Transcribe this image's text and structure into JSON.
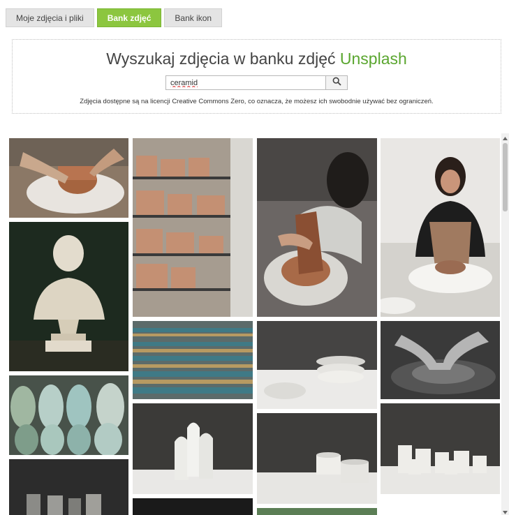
{
  "tabs": [
    {
      "label": "Moje zdjęcia i pliki",
      "active": false
    },
    {
      "label": "Bank zdjęć",
      "active": true
    },
    {
      "label": "Bank ikon",
      "active": false
    }
  ],
  "search": {
    "title_prefix": "Wyszukaj zdjęcia w banku zdjęć ",
    "title_brand": "Unsplash",
    "query": "ceramid",
    "button_icon": "search-icon",
    "license_note": "Zdjęcia dostępne są na licencji Creative Commons Zero, co oznacza, że możesz ich swobodnie używać bez ograniczeń."
  },
  "colors": {
    "accent_green": "#8cc63f",
    "brand_green": "#5aa62f",
    "tab_inactive": "#e4e4e4"
  },
  "gallery": {
    "photos": [
      {
        "subject": "hands-shaping-clay-on-wheel"
      },
      {
        "subject": "shelves-of-terracotta-pots"
      },
      {
        "subject": "potter-at-wheel-closeup"
      },
      {
        "subject": "woman-throwing-pottery"
      },
      {
        "subject": "white-marble-bust"
      },
      {
        "subject": "mosaic-tiled-steps"
      },
      {
        "subject": "stacked-white-bowls"
      },
      {
        "subject": "black-and-white-hands-on-clay"
      },
      {
        "subject": "glazed-ceramic-vases"
      },
      {
        "subject": "white-bottles-on-table"
      },
      {
        "subject": "white-mugs-on-table"
      },
      {
        "subject": "white-cups-group"
      },
      {
        "subject": "grey-cylinders"
      },
      {
        "subject": "dark-photo-partial"
      },
      {
        "subject": "green-photo-partial"
      }
    ]
  },
  "scrollbar": {
    "up_icon": "arrow-up-icon",
    "down_icon": "arrow-down-icon"
  }
}
